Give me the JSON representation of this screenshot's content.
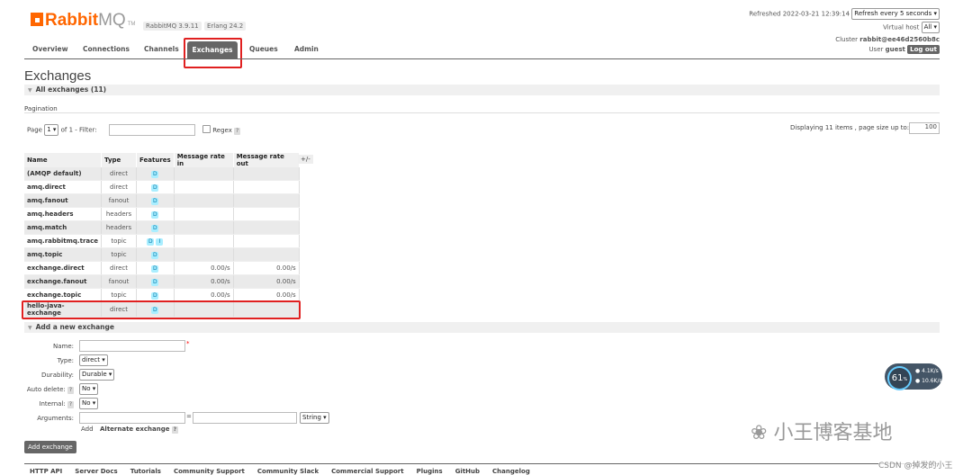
{
  "header": {
    "logo_main": "Rabbit",
    "logo_mq": "MQ",
    "logo_tm": "TM",
    "version": "RabbitMQ 3.9.11",
    "erlang": "Erlang 24.2",
    "refreshed": "Refreshed 2022-03-21 12:39:14",
    "refresh_select": "Refresh every 5 seconds",
    "vhost_label": "Virtual host",
    "vhost_select": "All",
    "cluster_label": "Cluster",
    "cluster_name": "rabbit@ee46d2560b8c",
    "user_label": "User",
    "user_name": "guest",
    "logout": "Log out"
  },
  "nav": {
    "overview": "Overview",
    "connections": "Connections",
    "channels": "Channels",
    "exchanges": "Exchanges",
    "queues": "Queues",
    "admin": "Admin"
  },
  "page": {
    "title": "Exchanges",
    "all_exchanges": "All exchanges (11)",
    "pagination": "Pagination",
    "page_label": "Page",
    "page_select": "1",
    "of_label": "of 1  - Filter:",
    "regex_label": "Regex",
    "help": "?",
    "displaying": "Displaying 11 items , page size up to:",
    "page_size": "100"
  },
  "table": {
    "headers": [
      "Name",
      "Type",
      "Features",
      "Message rate in",
      "Message rate out"
    ],
    "plusminus": "+/-",
    "rows": [
      {
        "name": "(AMQP default)",
        "type": "direct",
        "features": [
          "D"
        ],
        "in": "",
        "out": ""
      },
      {
        "name": "amq.direct",
        "type": "direct",
        "features": [
          "D"
        ],
        "in": "",
        "out": ""
      },
      {
        "name": "amq.fanout",
        "type": "fanout",
        "features": [
          "D"
        ],
        "in": "",
        "out": ""
      },
      {
        "name": "amq.headers",
        "type": "headers",
        "features": [
          "D"
        ],
        "in": "",
        "out": ""
      },
      {
        "name": "amq.match",
        "type": "headers",
        "features": [
          "D"
        ],
        "in": "",
        "out": ""
      },
      {
        "name": "amq.rabbitmq.trace",
        "type": "topic",
        "features": [
          "D",
          "I"
        ],
        "in": "",
        "out": ""
      },
      {
        "name": "amq.topic",
        "type": "topic",
        "features": [
          "D"
        ],
        "in": "",
        "out": ""
      },
      {
        "name": "exchange.direct",
        "type": "direct",
        "features": [
          "D"
        ],
        "in": "0.00/s",
        "out": "0.00/s"
      },
      {
        "name": "exchange.fanout",
        "type": "fanout",
        "features": [
          "D"
        ],
        "in": "0.00/s",
        "out": "0.00/s"
      },
      {
        "name": "exchange.topic",
        "type": "topic",
        "features": [
          "D"
        ],
        "in": "0.00/s",
        "out": "0.00/s"
      },
      {
        "name": "hello-java-exchange",
        "type": "direct",
        "features": [
          "D"
        ],
        "in": "",
        "out": ""
      }
    ]
  },
  "add": {
    "section": "Add a new exchange",
    "name_label": "Name:",
    "required": "*",
    "type_label": "Type:",
    "type_value": "direct",
    "durability_label": "Durability:",
    "durability_value": "Durable",
    "autodelete_label": "Auto delete:",
    "autodelete_value": "No",
    "internal_label": "Internal:",
    "internal_value": "No",
    "arguments_label": "Arguments:",
    "equals": "=",
    "arg_type": "String",
    "add_link": "Add",
    "alternate": "Alternate exchange",
    "button": "Add exchange"
  },
  "footer": [
    "HTTP API",
    "Server Docs",
    "Tutorials",
    "Community Support",
    "Community Slack",
    "Commercial Support",
    "Plugins",
    "GitHub",
    "Changelog"
  ],
  "gauge": {
    "value": "61",
    "unit": "%",
    "up": "4.1",
    "up_unit": "K/s",
    "down": "10.6",
    "down_unit": "K/s"
  },
  "watermark": "小王博客基地",
  "csdn": "CSDN @掉发的小王"
}
